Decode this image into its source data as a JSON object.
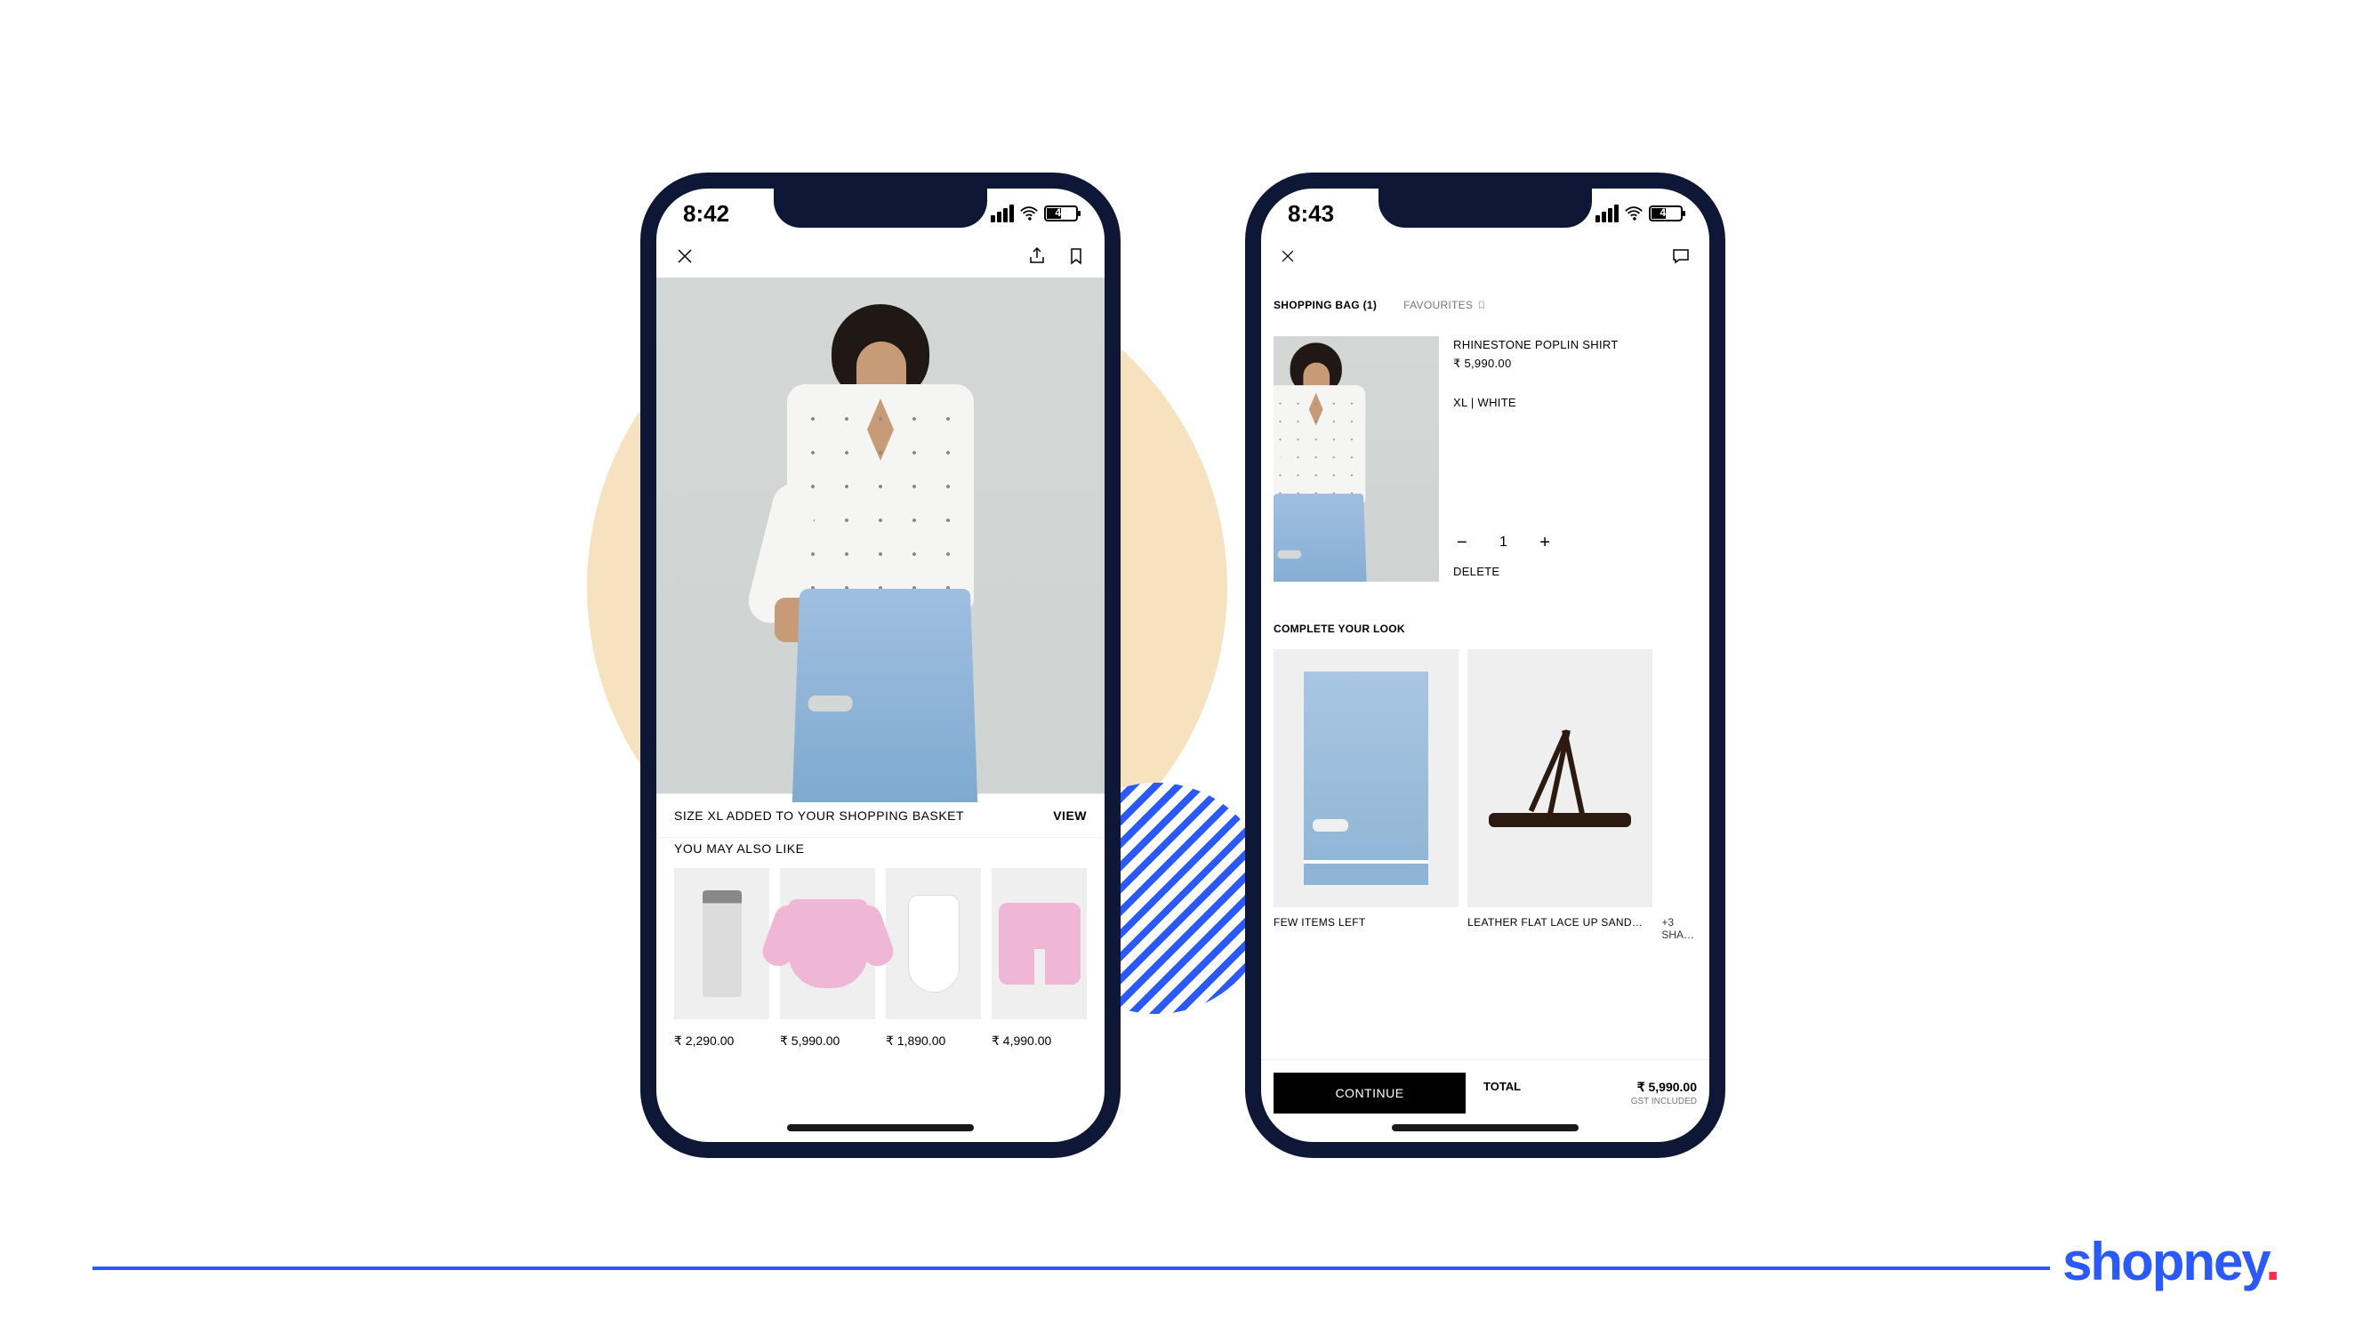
{
  "brand": "shopney",
  "phone1": {
    "status": {
      "time": "8:42",
      "battery": "47"
    },
    "added_bar": {
      "text": "SIZE XL ADDED TO YOUR SHOPPING BASKET",
      "view": "VIEW"
    },
    "you_may_also_like": "YOU MAY ALSO LIKE",
    "recs": [
      {
        "price": "₹ 2,290.00"
      },
      {
        "price": "₹ 5,990.00"
      },
      {
        "price": "₹ 1,890.00"
      },
      {
        "price": "₹ 4,990.00"
      }
    ]
  },
  "phone2": {
    "status": {
      "time": "8:43",
      "battery": "47"
    },
    "tabs": {
      "bag": "SHOPPING BAG (1)",
      "fav": "FAVOURITES"
    },
    "item": {
      "name": "RHINESTONE POPLIN SHIRT",
      "price": "₹ 5,990.00",
      "variant": "XL | WHITE",
      "qty": "1",
      "delete": "DELETE"
    },
    "complete": "COMPLETE YOUR LOOK",
    "cyl": [
      {
        "caption": "FEW ITEMS LEFT"
      },
      {
        "caption": "LEATHER FLAT LACE UP SAND…"
      },
      {
        "more": "+3 SHA…"
      }
    ],
    "checkout": {
      "continue": "CONTINUE",
      "total_label": "TOTAL",
      "total_amount": "₹ 5,990.00",
      "gst": "GST INCLUDED"
    }
  }
}
